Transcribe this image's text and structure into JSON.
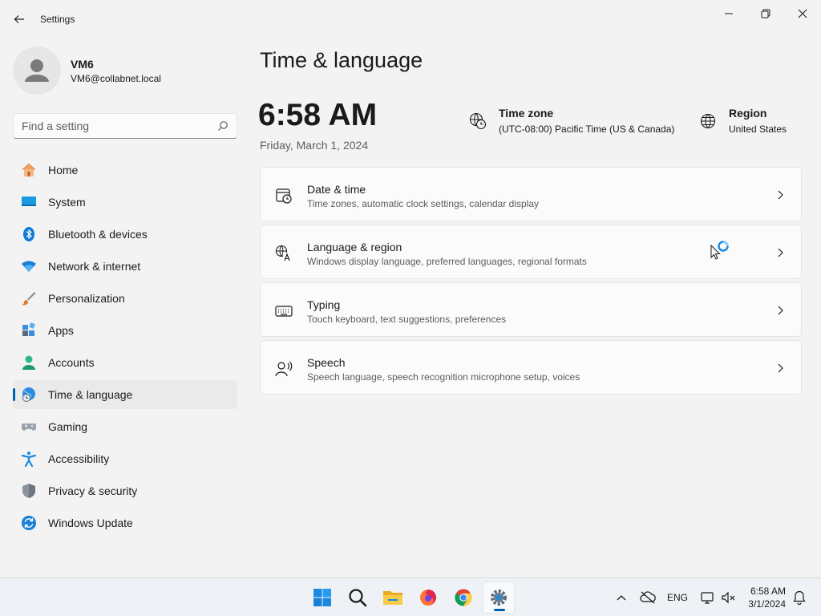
{
  "window": {
    "app_title": "Settings"
  },
  "user": {
    "name": "VM6",
    "email": "VM6@collabnet.local"
  },
  "search": {
    "placeholder": "Find a setting"
  },
  "nav": {
    "items": [
      {
        "label": "Home",
        "icon": "home-icon"
      },
      {
        "label": "System",
        "icon": "system-icon"
      },
      {
        "label": "Bluetooth & devices",
        "icon": "bluetooth-icon"
      },
      {
        "label": "Network & internet",
        "icon": "wifi-icon"
      },
      {
        "label": "Personalization",
        "icon": "brush-icon"
      },
      {
        "label": "Apps",
        "icon": "apps-icon"
      },
      {
        "label": "Accounts",
        "icon": "accounts-icon"
      },
      {
        "label": "Time & language",
        "icon": "globe-clock-icon",
        "active": true
      },
      {
        "label": "Gaming",
        "icon": "gamepad-icon"
      },
      {
        "label": "Accessibility",
        "icon": "accessibility-icon"
      },
      {
        "label": "Privacy & security",
        "icon": "shield-icon"
      },
      {
        "label": "Windows Update",
        "icon": "update-icon"
      }
    ]
  },
  "main": {
    "title": "Time & language",
    "time": "6:58 AM",
    "date": "Friday, March 1, 2024",
    "timezone": {
      "label": "Time zone",
      "value": "(UTC-08:00) Pacific Time (US & Canada)"
    },
    "region": {
      "label": "Region",
      "value": "United States"
    },
    "cards": [
      {
        "title": "Date & time",
        "desc": "Time zones, automatic clock settings, calendar display",
        "icon": "calendar-clock-icon"
      },
      {
        "title": "Language & region",
        "desc": "Windows display language, preferred languages, regional formats",
        "icon": "language-icon"
      },
      {
        "title": "Typing",
        "desc": "Touch keyboard, text suggestions, preferences",
        "icon": "keyboard-icon"
      },
      {
        "title": "Speech",
        "desc": "Speech language, speech recognition microphone setup, voices",
        "icon": "speech-icon"
      }
    ]
  },
  "taskbar": {
    "apps": [
      "start-icon",
      "search-icon",
      "file-explorer-icon",
      "firefox-icon",
      "chrome-icon",
      "settings-icon"
    ],
    "running_app": "settings-icon",
    "language": "ENG",
    "clock_time": "6:58 AM",
    "clock_date": "3/1/2024"
  },
  "colors": {
    "accent": "#005fb8",
    "window_bg": "#f3f3f3",
    "card_bg": "#fbfbfb"
  }
}
